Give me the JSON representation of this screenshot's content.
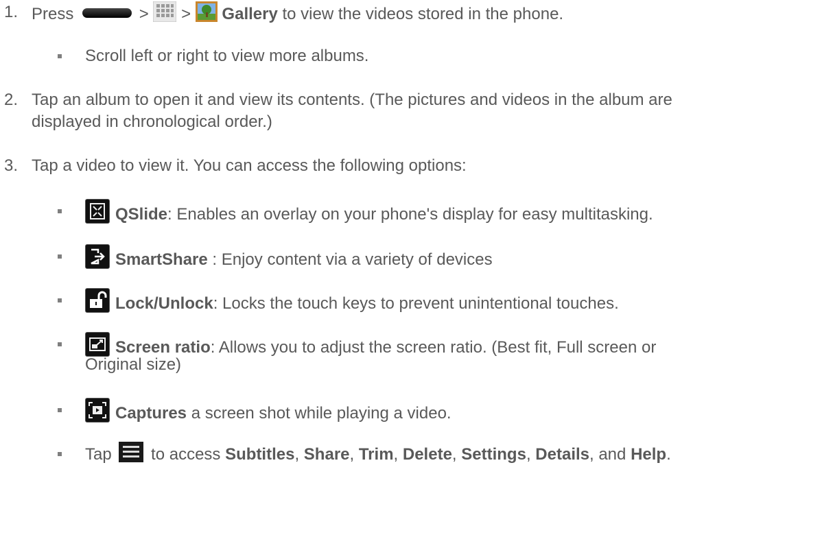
{
  "steps": [
    {
      "number": "1.",
      "press": "Press",
      "sep1": ">",
      "sep2": ">",
      "gallery": "Gallery",
      "rest": "to view the videos stored in the phone."
    },
    {
      "number": "2.",
      "line1": "Tap an album to open it and view its contents. (The pictures and videos in the album are",
      "line2": "displayed in chronological order.)"
    },
    {
      "number": "3.",
      "text": "Tap a video to view it. You can access the following options:"
    }
  ],
  "step1_bullet": "Scroll left or right to view more albums.",
  "options": [
    {
      "icon": "qslide-icon",
      "term": "QSlide",
      "desc": ": Enables an overlay on your phone's display for easy multitasking."
    },
    {
      "icon": "smartshare-icon",
      "term": "SmartShare",
      "desc": " : Enjoy content via a variety of devices"
    },
    {
      "icon": "lock-icon",
      "term": "Lock/Unlock",
      "desc": ": Locks the touch keys to prevent unintentional touches."
    },
    {
      "icon": "screen-ratio-icon",
      "term": "Screen ratio",
      "desc": ": Allows you to adjust the screen ratio. (Best fit, Full screen or",
      "desc2": "Original size)"
    },
    {
      "icon": "capture-icon",
      "term": "Captures",
      "desc": " a screen shot while playing a video."
    }
  ],
  "menu_line": {
    "tap": "Tap",
    "to_access": "to access",
    "items": [
      "Subtitles",
      "Share",
      "Trim",
      "Delete",
      "Settings",
      "Details",
      "Help"
    ],
    "comma": ",",
    "and": ", and",
    "period": "."
  }
}
